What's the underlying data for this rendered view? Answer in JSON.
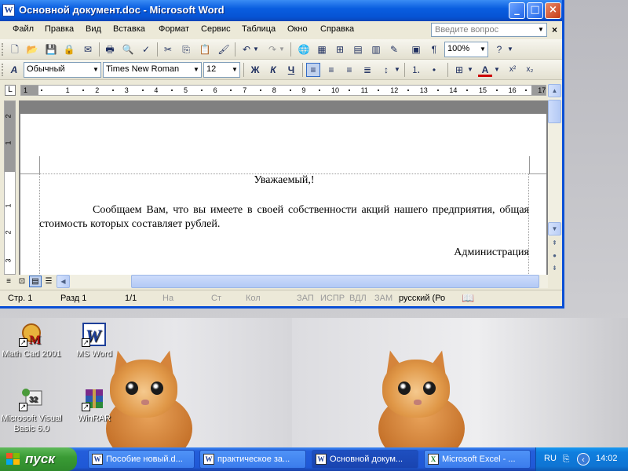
{
  "window": {
    "title": "Основной документ.doc - Microsoft Word",
    "minimize": "_",
    "maximize": "□",
    "close": "×"
  },
  "menu": {
    "items": [
      "Файл",
      "Правка",
      "Вид",
      "Вставка",
      "Формат",
      "Сервис",
      "Таблица",
      "Окно",
      "Справка"
    ],
    "help_placeholder": "Введите вопрос",
    "doc_close": "×"
  },
  "toolbar_standard": {
    "zoom": "100%"
  },
  "toolbar_format": {
    "style": "Обычный",
    "font": "Times New Roman",
    "size": "12",
    "bold": "Ж",
    "italic": "К",
    "underline": "Ч"
  },
  "ruler": {
    "labels": [
      "1",
      "1",
      "2",
      "3",
      "4",
      "5",
      "6",
      "7",
      "8",
      "9",
      "10",
      "11",
      "12",
      "13",
      "14",
      "15",
      "16",
      "17"
    ]
  },
  "vruler": {
    "labels": [
      "2",
      "1",
      "1",
      "2",
      "3"
    ]
  },
  "document": {
    "greeting": "Уважаемый,!",
    "paragraph": "Сообщаем Вам, что вы имеете в своей собственности акций нашего предприятия, общая стоимость которых составляет рублей.",
    "signature": "Администрация"
  },
  "status": {
    "page": "Стр. 1",
    "section": "Разд 1",
    "pages": "1/1",
    "at": "На",
    "line": "Ст",
    "col": "Кол",
    "rec": "ЗАП",
    "trk": "ИСПР",
    "ext": "ВДЛ",
    "ovr": "ЗАМ",
    "language": "русский (Ро"
  },
  "desktop_icons": [
    {
      "label": "Math Cad 2001"
    },
    {
      "label": "MS Word"
    },
    {
      "label": "Microsoft Visual Basic 6.0"
    },
    {
      "label": "WinRAR"
    }
  ],
  "taskbar": {
    "start": "пуск",
    "tasks": [
      {
        "label": "Пособие новый.d..."
      },
      {
        "label": "практическое за..."
      },
      {
        "label": "Основной докум..."
      },
      {
        "label": "Microsoft Excel - ..."
      }
    ],
    "language": "RU",
    "clock": "14:02"
  },
  "colors": {
    "titlebar": "#0a5ee0",
    "taskbar": "#245edb",
    "start": "#3a9b35"
  }
}
